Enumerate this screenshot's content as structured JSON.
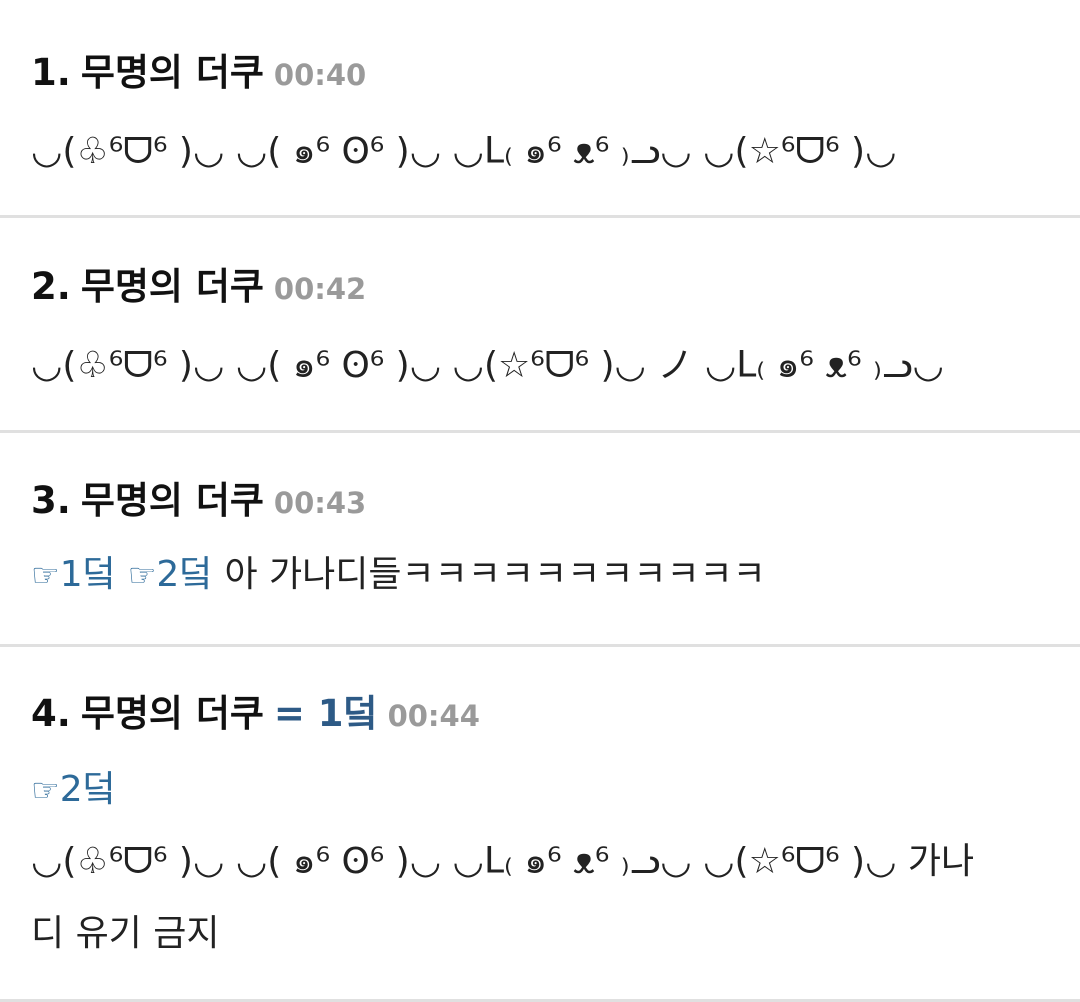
{
  "posts": [
    {
      "num": "1.",
      "author": "무명의 더쿠",
      "time": "00:40",
      "line1": "◡(♧⁶ᗜ⁶ )◡ ◡( ๑⁶ ʘ⁶ )◡ ◡ᒪ₍ ๑⁶ ᴥ⁶ ₎ᓗ◡ ◡(☆⁶ᗜ⁶ )◡"
    },
    {
      "num": "2.",
      "author": "무명의 더쿠",
      "time": "00:42",
      "line1": "◡(♧⁶ᗜ⁶ )◡ ◡( ๑⁶ ʘ⁶ )◡ ◡(☆⁶ᗜ⁶ )◡ ノ ◡ᒪ₍ ๑⁶ ᴥ⁶ ₎ᓗ◡"
    },
    {
      "num": "3.",
      "author": "무명의 더쿠",
      "time": "00:43",
      "anchor1": "1덬",
      "anchor2": "2덬",
      "hand": "☞",
      "text": "아 가나디들ㅋㅋㅋㅋㅋㅋㅋㅋㅋㅋㅋ"
    },
    {
      "num": "4.",
      "author": "무명의 더쿠",
      "alias": "= 1덬",
      "time": "00:44",
      "hand": "☞",
      "anchor1": "2덬",
      "line2": "◡(♧⁶ᗜ⁶ )◡ ◡( ๑⁶ ʘ⁶ )◡ ◡ᒪ₍ ๑⁶ ᴥ⁶ ₎ᓗ◡ ◡(☆⁶ᗜ⁶ )◡ 가나",
      "line3": "디 유기 금지"
    }
  ]
}
